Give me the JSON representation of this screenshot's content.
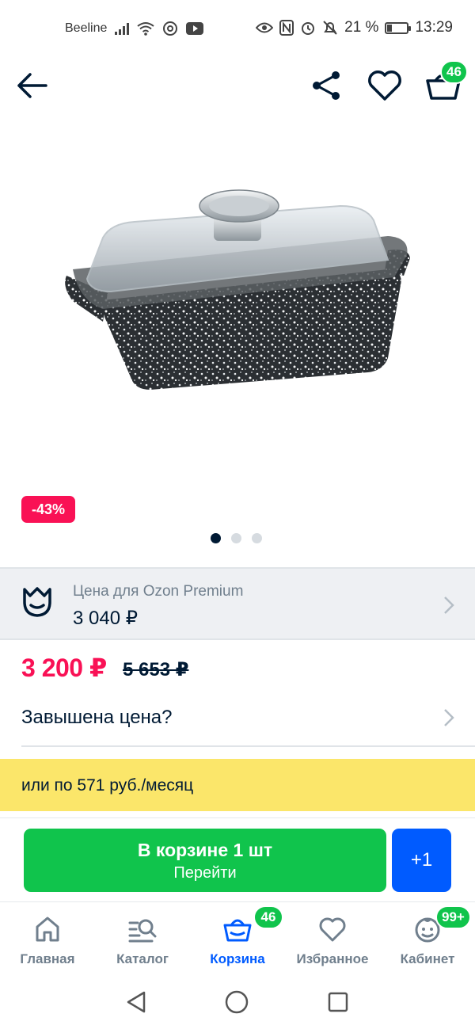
{
  "status_bar": {
    "carrier": "Beeline",
    "battery_percent": "21 %",
    "time": "13:29"
  },
  "header": {
    "cart_count": "46"
  },
  "product": {
    "discount_badge": "-43%",
    "gallery_total": 3,
    "gallery_active_index": 0
  },
  "premium": {
    "label": "Цена для Ozon Premium",
    "price": "3 040 ₽"
  },
  "pricing": {
    "current_price": "3 200 ₽",
    "old_price": "5 653 ₽"
  },
  "overpriced": {
    "label": "Завышена цена?"
  },
  "installment": {
    "text": "или по 571 руб./месяц"
  },
  "action_bar": {
    "cart_line1": "В корзине 1 шт",
    "cart_line2": "Перейти",
    "plus_label": "+1"
  },
  "tabbar": {
    "tabs": [
      {
        "label": "Главная"
      },
      {
        "label": "Каталог"
      },
      {
        "label": "Корзина",
        "badge": "46"
      },
      {
        "label": "Избранное"
      },
      {
        "label": "Кабинет",
        "badge": "99+"
      }
    ]
  },
  "colors": {
    "accent_blue": "#005bff",
    "sale_red": "#f91155",
    "green": "#10c44c",
    "installment_yellow": "#fbe66a"
  }
}
